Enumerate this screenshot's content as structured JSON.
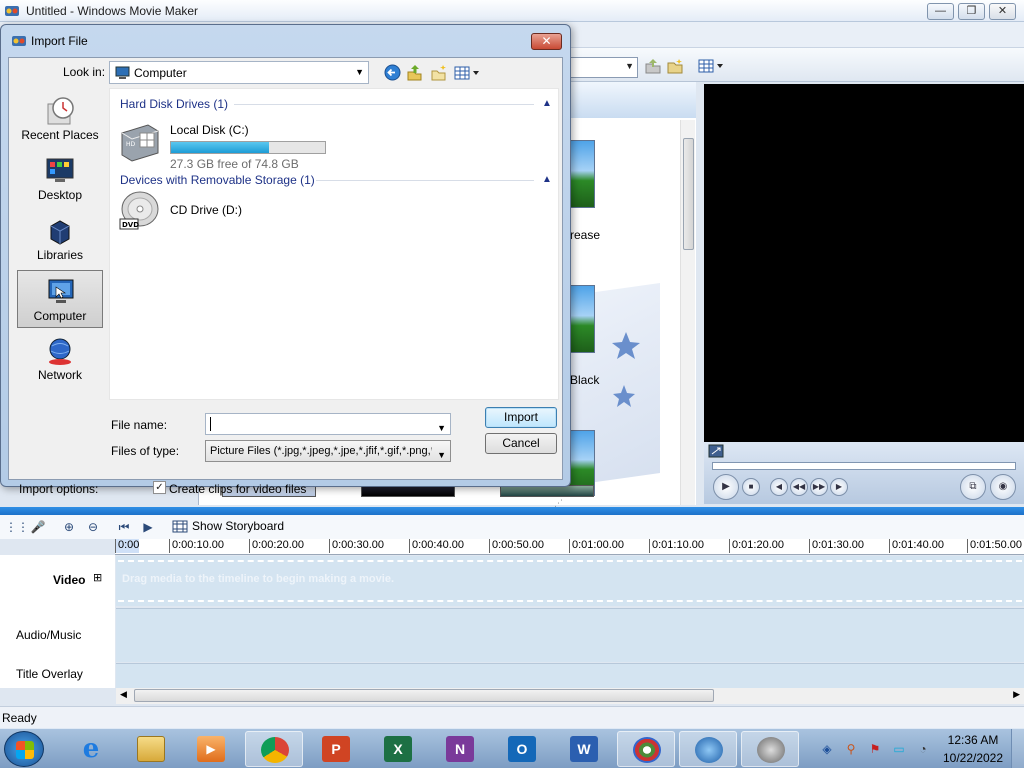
{
  "app": {
    "title": "Untitled - Windows Movie Maker",
    "minimize": "—",
    "maximize": "❐",
    "close": "✕"
  },
  "content": {
    "labels": [
      "rease",
      "Black"
    ]
  },
  "dialog": {
    "title": "Import File",
    "close": "✕",
    "look_in_label": "Look in:",
    "look_in_value": "Computer",
    "places": [
      "Recent Places",
      "Desktop",
      "Libraries",
      "Computer",
      "Network"
    ],
    "selected_place": "Computer",
    "groups": [
      {
        "header": "Hard Disk Drives (1)"
      },
      {
        "header": "Devices with Removable Storage (1)"
      }
    ],
    "drives": {
      "local_disk_name": "Local Disk (C:)",
      "local_disk_free": "27.3 GB free of 74.8 GB",
      "local_disk_used_fraction": 0.635,
      "cd_drive_name": "CD Drive (D:)"
    },
    "file_name_label": "File name:",
    "file_name_value": "",
    "files_of_type_label": "Files of type:",
    "files_of_type_value": "Picture Files (*.jpg,*.jpeg,*.jpe,*.jfif,*.gif,*.png,*.b",
    "import_button": "Import",
    "cancel_button": "Cancel",
    "import_options_label": "Import options:",
    "create_clips_label": "Create clips for video files",
    "create_clips_checked": true
  },
  "timeline": {
    "show_storyboard": "Show Storyboard",
    "ruler_ticks": [
      "0:00",
      "0:00:10.00",
      "0:00:20.00",
      "0:00:30.00",
      "0:00:40.00",
      "0:00:50.00",
      "0:01:00.00",
      "0:01:10.00",
      "0:01:20.00",
      "0:01:30.00",
      "0:01:40.00",
      "0:01:50.00"
    ],
    "tracks": {
      "video": "Video",
      "audio": "Audio/Music",
      "title_overlay": "Title Overlay"
    },
    "drag_hint": "Drag media to the timeline to begin making a movie.",
    "expand_icon": "⊞"
  },
  "status": {
    "text": "Ready"
  },
  "taskbar": {
    "clock_time": "12:36 AM",
    "clock_date": "10/22/2022",
    "apps": [
      "internet-explorer",
      "file-explorer",
      "media-player",
      "chrome",
      "powerpoint",
      "excel",
      "onenote",
      "outlook",
      "word",
      "windows-media-center",
      "app-globe",
      "movie-maker"
    ]
  },
  "colors": {
    "accent_blue": "#1d71c9",
    "group_header": "#1e3287",
    "drive_fill": "#1d9cd6"
  }
}
